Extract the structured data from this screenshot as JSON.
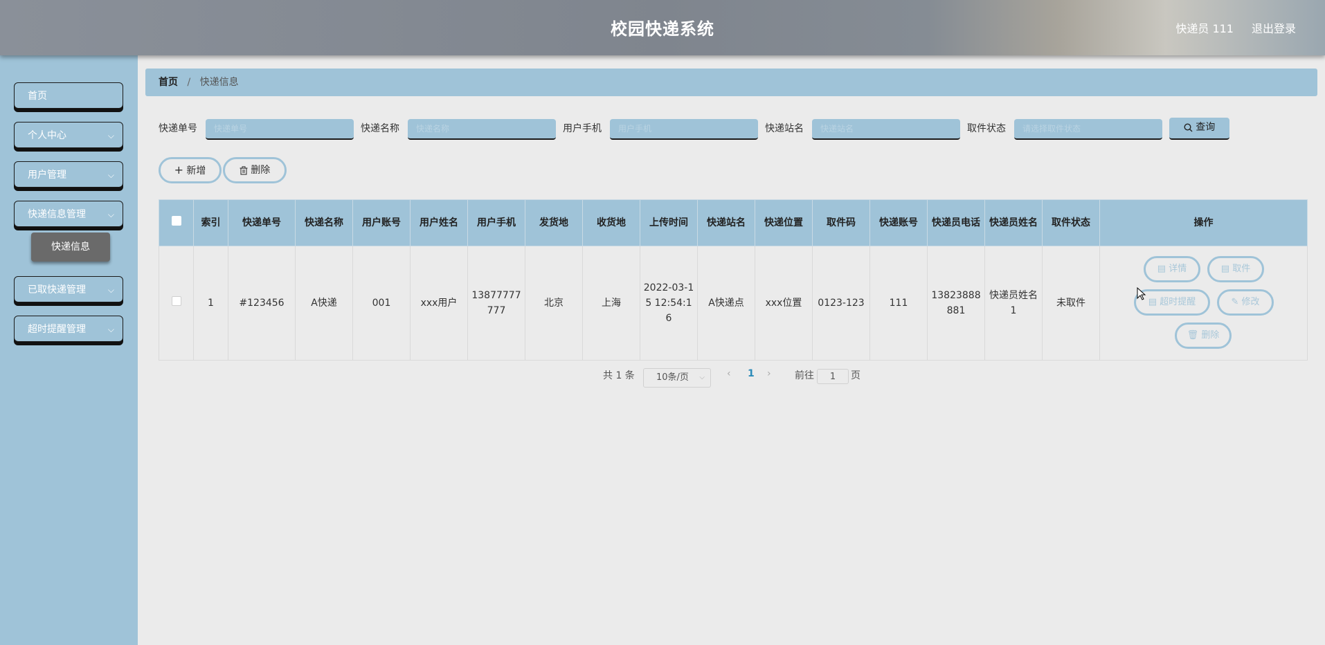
{
  "header": {
    "title": "校园快递系统",
    "user": "快递员 111",
    "logout": "退出登录"
  },
  "sidebar": {
    "items": [
      {
        "label": "首页",
        "has_arrow": false
      },
      {
        "label": "个人中心",
        "has_arrow": true
      },
      {
        "label": "用户管理",
        "has_arrow": true
      },
      {
        "label": "快递信息管理",
        "has_arrow": true
      },
      {
        "label": "已取快递管理",
        "has_arrow": true
      },
      {
        "label": "超时提醒管理",
        "has_arrow": true
      }
    ],
    "submenu": {
      "label": "快递信息"
    }
  },
  "breadcrumb": {
    "home": "首页",
    "current": "快递信息",
    "separator": "/"
  },
  "search": {
    "fields": [
      {
        "label": "快递单号",
        "placeholder": "快递单号"
      },
      {
        "label": "快递名称",
        "placeholder": "快递名称"
      },
      {
        "label": "用户手机",
        "placeholder": "用户手机"
      },
      {
        "label": "快递站名",
        "placeholder": "快递站名"
      },
      {
        "label": "取件状态",
        "placeholder": "请选择取件状态"
      }
    ],
    "button": "查询"
  },
  "actions": {
    "add": "新增",
    "delete": "删除"
  },
  "table": {
    "headers": [
      "索引",
      "快递单号",
      "快递名称",
      "用户账号",
      "用户姓名",
      "用户手机",
      "发货地",
      "收货地",
      "上传时间",
      "快递站名",
      "快递位置",
      "取件码",
      "快递账号",
      "快递员电话",
      "快递员姓名",
      "取件状态",
      "操作"
    ],
    "rows": [
      {
        "index": "1",
        "tracking_no": "#123456",
        "express_name": "A快递",
        "user_account": "001",
        "user_name": "xxx用户",
        "user_phone": "13877777777",
        "origin": "北京",
        "destination": "上海",
        "upload_time": "2022-03-15 12:54:16",
        "station": "A快递点",
        "location": "xxx位置",
        "pickup_code": "0123-123",
        "courier_account": "111",
        "courier_phone": "13823888881",
        "courier_name": "快递员姓名1",
        "status": "未取件"
      }
    ],
    "row_actions": {
      "detail": "详情",
      "pickup": "取件",
      "remind": "超时提醒",
      "edit": "修改",
      "delete": "删除"
    }
  },
  "pagination": {
    "total": "共 1 条",
    "page_size": "10条/页",
    "current": "1",
    "goto_label": "前往",
    "goto_value": "1",
    "page_suffix": "页"
  },
  "colors": {
    "accent": "#9fc3d8",
    "header": "#808790",
    "background": "#ebebeb",
    "submenu": "#6a6a6a"
  }
}
